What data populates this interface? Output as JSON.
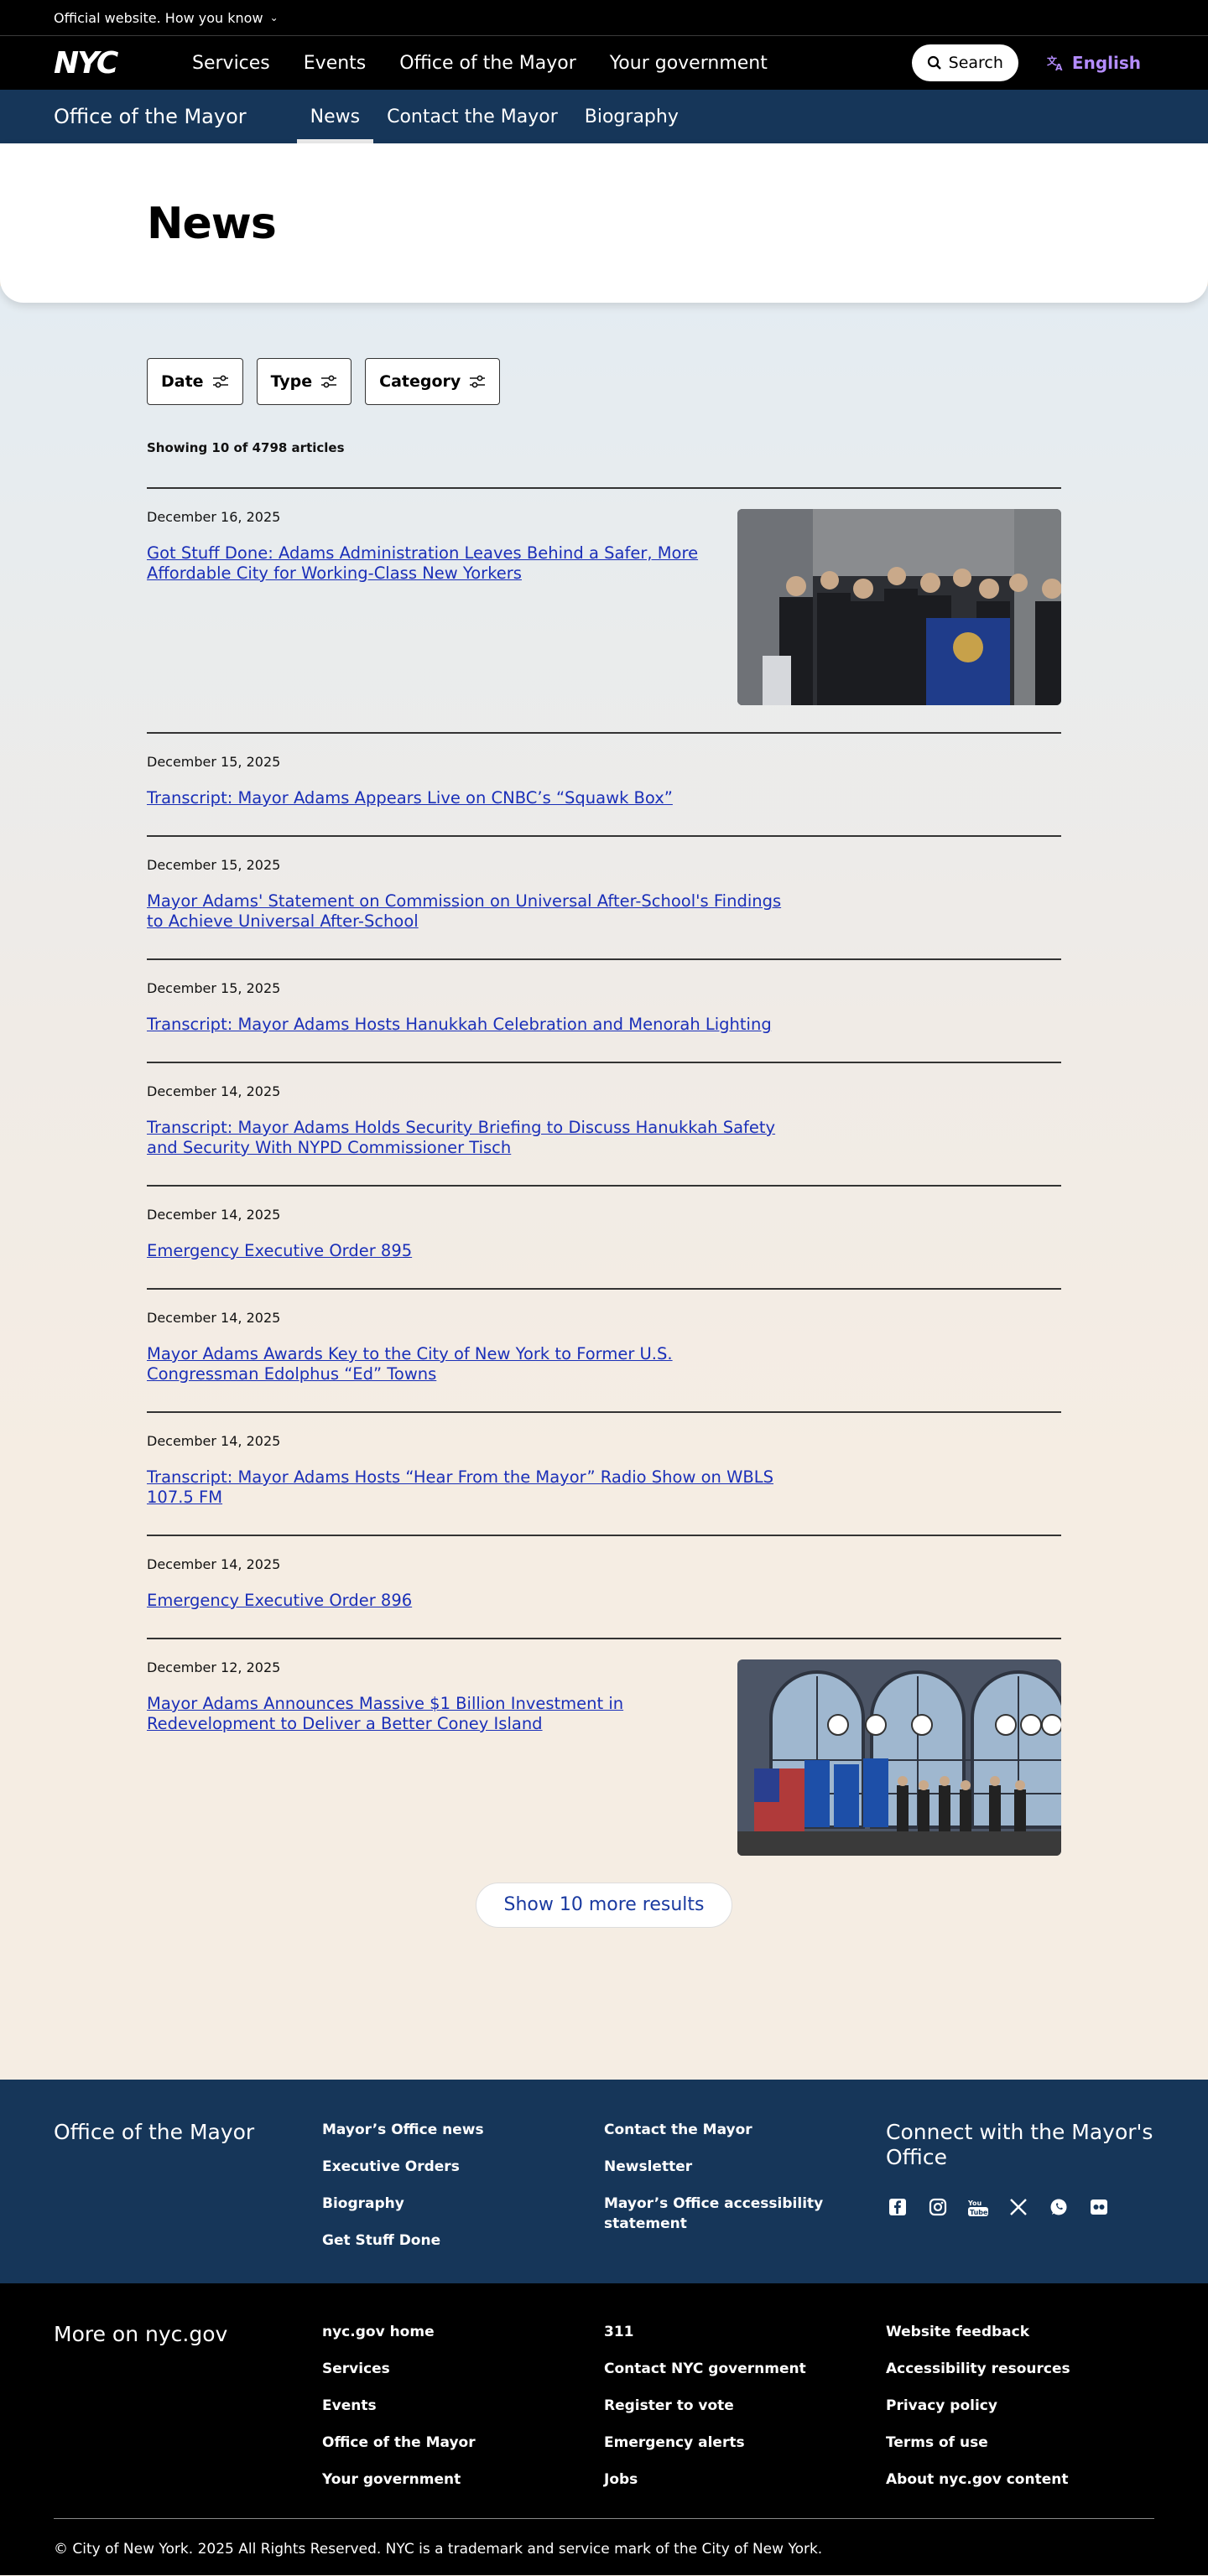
{
  "official": {
    "text": "Official website. How you know"
  },
  "nav": {
    "logo": "NYC",
    "links": [
      "Services",
      "Events",
      "Office of the Mayor",
      "Your government"
    ],
    "search": "Search",
    "language": "English"
  },
  "subnav": {
    "site": "Office of the Mayor",
    "tabs": [
      "News",
      "Contact the Mayor",
      "Biography"
    ]
  },
  "page": {
    "title": "News"
  },
  "filters": [
    "Date",
    "Type",
    "Category"
  ],
  "count": "Showing 10 of 4798 articles",
  "articles": [
    {
      "date": "December 16, 2025",
      "title": "Got Stuff Done: Adams Administration Leaves Behind a Safer, More Affordable City for Working-Class New Yorkers"
    },
    {
      "date": "December 15, 2025",
      "title": "Transcript: Mayor Adams Appears Live on CNBC’s “Squawk Box”"
    },
    {
      "date": "December 15, 2025",
      "title": "Mayor Adams' Statement on Commission on Universal After-School's Findings to Achieve Universal After-School"
    },
    {
      "date": "December 15, 2025",
      "title": "Transcript: Mayor Adams Hosts Hanukkah Celebration and Menorah Lighting"
    },
    {
      "date": "December 14, 2025",
      "title": "Transcript: Mayor Adams Holds Security Briefing to Discuss Hanukkah Safety and Security With NYPD Commissioner Tisch"
    },
    {
      "date": "December 14, 2025",
      "title": "Emergency Executive Order 895"
    },
    {
      "date": "December 14, 2025",
      "title": "Mayor Adams Awards Key to the City of New York to Former U.S. Congressman Edolphus “Ed” Towns"
    },
    {
      "date": "December 14, 2025",
      "title": "Transcript: Mayor Adams Hosts “Hear From the Mayor” Radio Show on WBLS 107.5 FM"
    },
    {
      "date": "December 14, 2025",
      "title": "Emergency Executive Order 896"
    },
    {
      "date": "December 12, 2025",
      "title": "Mayor Adams Announces Massive $1 Billion Investment in Redevelopment to Deliver a Better Coney Island"
    }
  ],
  "more_button": "Show 10 more results",
  "footer1": {
    "title": "Office of the Mayor",
    "col1": [
      "Mayor’s Office news",
      "Executive Orders",
      "Biography",
      "Get Stuff Done"
    ],
    "col2": [
      "Contact the Mayor",
      "Newsletter",
      "Mayor’s Office accessibility statement"
    ],
    "connect": "Connect with the Mayor's Office",
    "social_icons": [
      "facebook-icon",
      "instagram-icon",
      "youtube-icon",
      "x-icon",
      "whatsapp-icon",
      "flickr-icon"
    ]
  },
  "footer2": {
    "title": "More on nyc.gov",
    "col1": [
      "nyc.gov home",
      "Services",
      "Events",
      "Office of the Mayor",
      "Your government"
    ],
    "col2": [
      "311",
      "Contact NYC government",
      "Register to vote",
      "Emergency alerts",
      "Jobs"
    ],
    "col3": [
      "Website feedback",
      "Accessibility resources",
      "Privacy policy",
      "Terms of use",
      "About nyc.gov content"
    ],
    "copyright": "© City of New York. 2025 All Rights Reserved. NYC is a trademark and service mark of the City of New York."
  },
  "colors": {
    "nav_bg": "#000000",
    "subnav_bg": "#163659",
    "link": "#1a2fb8",
    "language": "#b48cff"
  }
}
